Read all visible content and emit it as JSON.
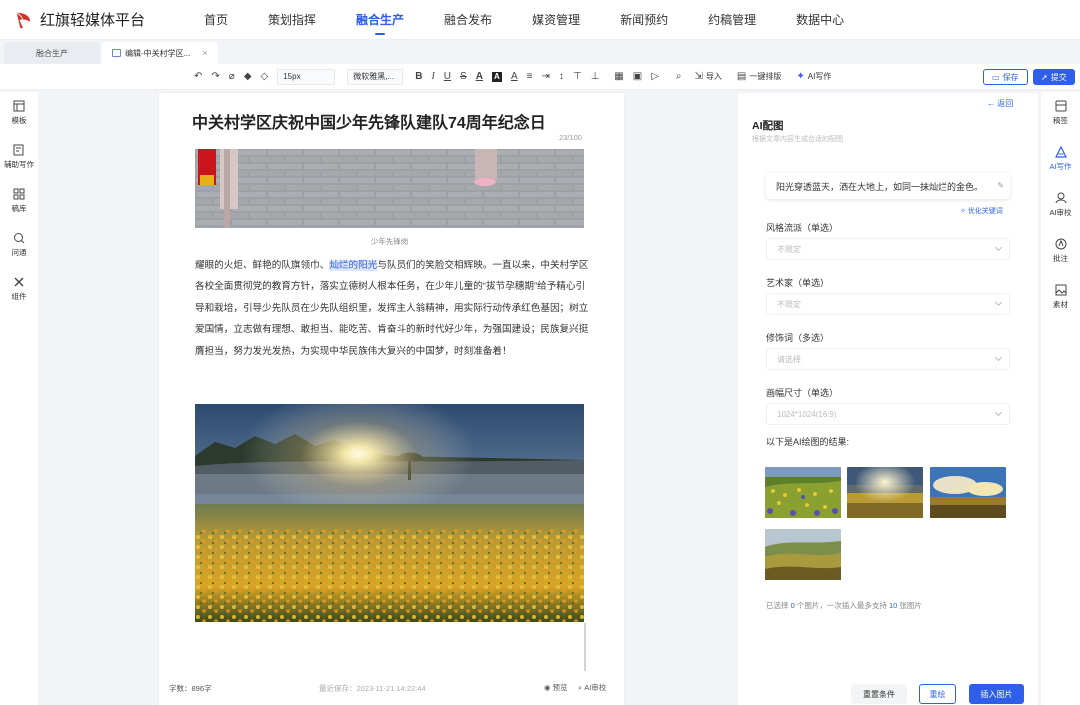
{
  "app": {
    "brand": "红旗轻媒体平台",
    "accent": "#2f5fe8",
    "nav": [
      {
        "label": "首页"
      },
      {
        "label": "策划指挥"
      },
      {
        "label": "融合生产",
        "active": true
      },
      {
        "label": "融合发布"
      },
      {
        "label": "媒资管理"
      },
      {
        "label": "新闻预约"
      },
      {
        "label": "约稿管理"
      },
      {
        "label": "数据中心"
      }
    ]
  },
  "tabs": [
    {
      "label": "融合生产"
    },
    {
      "label": "编辑-中关村学区...",
      "close": "×",
      "active": true
    }
  ],
  "toolbar": {
    "font_size": "15px",
    "font_family": "微软雅黑,...",
    "import_label": "导入",
    "format_label": "一键排版",
    "ai_write_label": "AI写作",
    "save_label": "保存",
    "submit_label": "提交"
  },
  "left_sidebar": [
    {
      "label": "模板",
      "icon": "template-icon"
    },
    {
      "label": "辅助写作",
      "icon": "assist-write-icon"
    },
    {
      "label": "稿库",
      "icon": "library-icon"
    },
    {
      "label": "问通",
      "icon": "ask-icon"
    },
    {
      "label": "组件",
      "icon": "component-icon"
    }
  ],
  "editor": {
    "title": "中关村学区庆祝中国少年先锋队建队74周年纪念日",
    "title_count": "23/100",
    "caption": "少年先锋岗",
    "para_before": "耀眼的火炬、鲜艳的队旗领巾、",
    "para_highlight": "灿烂的阳光",
    "para_after": "与队员们的笑脸交相辉映。一直以来，中关村学区各校全面贯彻党的教育方针，落实立德树人根本任务，在少年儿童的“拔节孕穗期”给予精心引导和栽培，引导少先队员在少先队组织里，发挥主人翁精神，用实际行动传承红色基因；树立爱国情，立志做有理想、敢担当、能吃苦、肯奋斗的新时代好少年，为强国建设；民族复兴挺膺担当，努力发光发热，为实现中华民族伟大复兴的中国梦，时刻准备着！",
    "word_count": "字数：896字",
    "last_saved": "最近保存：2023-11-21 14:22:44",
    "preview": "预览",
    "ai_review": "AI审校"
  },
  "ai_panel": {
    "back": "← 返回",
    "title": "AI配图",
    "subtitle": "根据文章内容生成合适的配图",
    "prompt": "阳光穿透蓝天，洒在大地上，如同一抹灿烂的金色。",
    "optimize": "优化关键词",
    "fields": [
      {
        "label": "风格流派（单选）",
        "value": "不限定"
      },
      {
        "label": "艺术家（单选）",
        "value": "不限定"
      },
      {
        "label": "修饰词（多选）",
        "value": "请选择"
      },
      {
        "label": "画幅尺寸（单选）",
        "value": "1024*1024(16:9)"
      }
    ],
    "result_label": "以下是AI绘图的结果:",
    "selected_prefix": "已选择",
    "selected_count": "0",
    "selected_mid": "个图片，一次插入最多支持",
    "selected_max": "10",
    "selected_suffix": "张图片",
    "reset": "重置条件",
    "redraw": "重绘",
    "insert": "插入图片"
  },
  "right_sidebar": [
    {
      "label": "稿签",
      "icon": "tag-icon"
    },
    {
      "label": "AI写作",
      "icon": "ai-write-icon",
      "active": true
    },
    {
      "label": "AI审校",
      "icon": "ai-review-icon"
    },
    {
      "label": "批注",
      "icon": "annotation-icon"
    },
    {
      "label": "素材",
      "icon": "material-icon"
    }
  ]
}
